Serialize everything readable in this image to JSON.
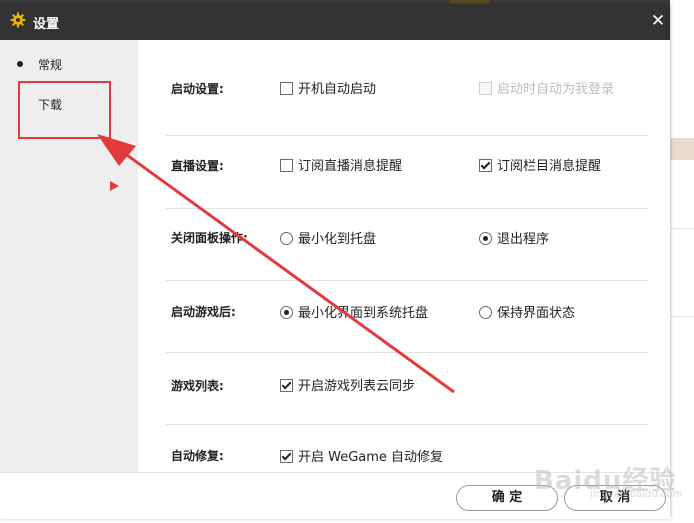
{
  "dialog": {
    "title": "设置",
    "icon": "gear-icon",
    "close_label": "✕"
  },
  "sidebar": {
    "items": [
      {
        "label": "常规",
        "selected": true
      },
      {
        "label": "下载",
        "selected": false
      }
    ]
  },
  "sections": [
    {
      "label": "启动设置:",
      "options": [
        {
          "kind": "checkbox",
          "label": "开机自动启动",
          "checked": false,
          "disabled": false
        },
        {
          "kind": "checkbox",
          "label": "启动时自动为我登录",
          "checked": false,
          "disabled": true
        }
      ]
    },
    {
      "label": "直播设置:",
      "options": [
        {
          "kind": "checkbox",
          "label": "订阅直播消息提醒",
          "checked": false,
          "disabled": false
        },
        {
          "kind": "checkbox",
          "label": "订阅栏目消息提醒",
          "checked": true,
          "disabled": false
        }
      ]
    },
    {
      "label": "关闭面板操作:",
      "options": [
        {
          "kind": "radio",
          "label": "最小化到托盘",
          "checked": false
        },
        {
          "kind": "radio",
          "label": "退出程序",
          "checked": true
        }
      ]
    },
    {
      "label": "启动游戏后:",
      "options": [
        {
          "kind": "radio",
          "label": "最小化界面到系统托盘",
          "checked": true
        },
        {
          "kind": "radio",
          "label": "保持界面状态",
          "checked": false
        }
      ]
    },
    {
      "label": "游戏列表:",
      "options": [
        {
          "kind": "checkbox",
          "label": "开启游戏列表云同步",
          "checked": true,
          "disabled": false
        }
      ]
    },
    {
      "label": "自动修复:",
      "options": [
        {
          "kind": "checkbox",
          "label": "开启 WeGame 自动修复",
          "checked": true,
          "disabled": false
        }
      ]
    }
  ],
  "footer": {
    "ok_label": "确 定",
    "cancel_label": "取 消"
  },
  "watermark": {
    "text": "Baidu经验",
    "sub": "jingyan.baidu.com"
  },
  "colors": {
    "titlebar": "#323232",
    "sidebar": "#eeeeee",
    "annotation_red": "#e23a3a",
    "gear_yellow": "#f0b400"
  }
}
